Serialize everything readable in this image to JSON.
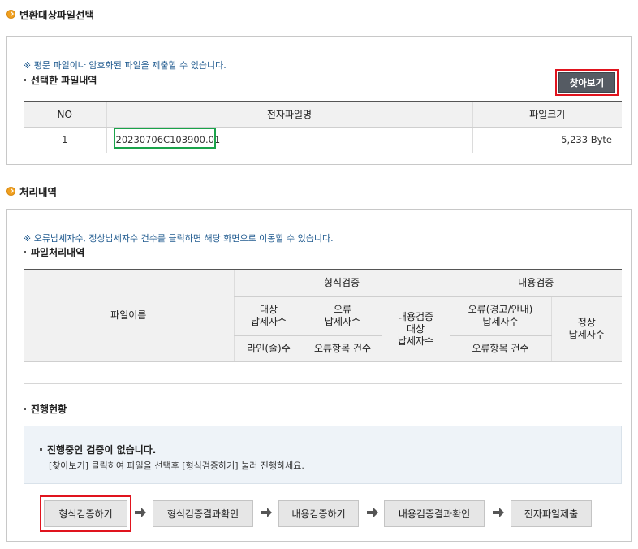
{
  "section1": {
    "title": "변환대상파일선택",
    "notice": "※ 평문 파일이나 암호화된 파일을 제출할 수 있습니다.",
    "subhead": "선택한 파일내역",
    "browse_button": "찾아보기",
    "table": {
      "headers": [
        "NO",
        "전자파일명",
        "파일크기"
      ],
      "rows": [
        {
          "no": "1",
          "filename": "20230706C103900.01",
          "size": "5,233 Byte"
        }
      ]
    }
  },
  "section2": {
    "title": "처리내역",
    "notice": "※ 오류납세자수, 정상납세자수 건수를 클릭하면 해당 화면으로 이동할 수 있습니다.",
    "subhead": "파일처리내역",
    "table": {
      "filename_header": "파일이름",
      "group_format": "형식검증",
      "group_content": "내용검증",
      "target_taxpayers": "대상\n납세자수",
      "error_taxpayers": "오류\n납세자수",
      "content_target": "내용검증\n대상\n납세자수",
      "error_warning": "오류(경고/안내)\n납세자수",
      "normal_taxpayers": "정상\n납세자수",
      "lines": "라인(줄)수",
      "error_items": "오류항목 건수",
      "error_items2": "오류항목 건수"
    },
    "progress_subhead": "진행현황",
    "progress_msg_title": "진행중인 검증이 없습니다.",
    "progress_msg_desc": "[찾아보기] 클릭하여 파일을 선택후 [형식검증하기] 눌러 진행하세요.",
    "steps": [
      "형식검증하기",
      "형식검증결과확인",
      "내용검증하기",
      "내용검증결과확인",
      "전자파일제출"
    ]
  },
  "colors": {
    "accent_orange": "#f0a020",
    "highlight_red": "#e0141e",
    "highlight_green": "#1aa34a",
    "notice_blue": "#1f5a8f"
  }
}
